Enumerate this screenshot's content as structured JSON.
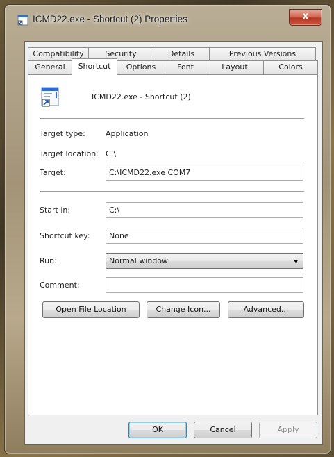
{
  "window": {
    "title": "ICMD22.exe - Shortcut (2) Properties",
    "close_label": "x"
  },
  "tabs": {
    "back_row": [
      "Compatibility",
      "Security",
      "Details",
      "Previous Versions"
    ],
    "front_row": [
      "General",
      "Shortcut",
      "Options",
      "Font",
      "Layout",
      "Colors"
    ],
    "active": "Shortcut"
  },
  "shortcut": {
    "name": "ICMD22.exe - Shortcut (2)",
    "target_type_label": "Target type:",
    "target_type_value": "Application",
    "target_location_label": "Target location:",
    "target_location_value": "C:\\",
    "target_label": "Target:",
    "target_value": "C:\\ICMD22.exe COM7",
    "start_in_label": "Start in:",
    "start_in_value": "C:\\",
    "shortcut_key_label": "Shortcut key:",
    "shortcut_key_value": "None",
    "run_label": "Run:",
    "run_value": "Normal window",
    "comment_label": "Comment:",
    "comment_value": ""
  },
  "buttons": {
    "open_file_location": "Open File Location",
    "change_icon": "Change Icon...",
    "advanced": "Advanced...",
    "ok": "OK",
    "cancel": "Cancel",
    "apply": "Apply"
  }
}
